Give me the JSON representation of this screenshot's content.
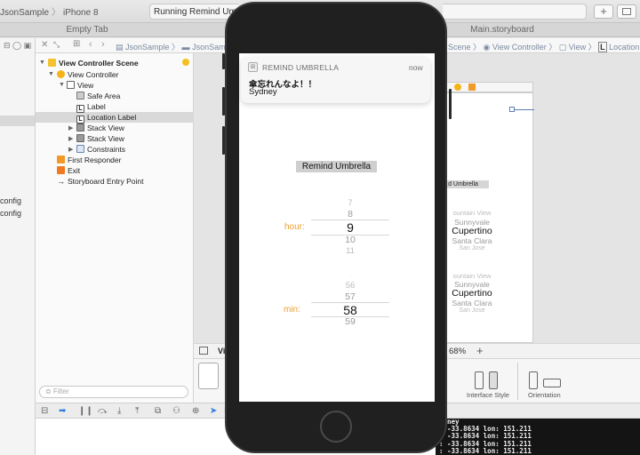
{
  "toolbar": {
    "scheme": "JsonSample",
    "device": "iPhone 8",
    "activity_status": "Running Remind Umbrella",
    "add_label": "+"
  },
  "tabs": {
    "left": "Empty Tab",
    "right": "Main.storyboard"
  },
  "navigator": {
    "config_items": [
      "config",
      "config"
    ]
  },
  "jumpbar": {
    "left": [
      "JsonSample",
      "JsonSample"
    ],
    "right": [
      "Scene",
      "View Controller",
      "View",
      "Location Label"
    ]
  },
  "outline": {
    "items": [
      {
        "label": "View Controller Scene",
        "icon": "scene-icon"
      },
      {
        "label": "View Controller",
        "icon": "view-controller-icon"
      },
      {
        "label": "View",
        "icon": "view-icon"
      },
      {
        "label": "Safe Area",
        "icon": "safe-area-icon"
      },
      {
        "label": "Label",
        "icon": "label-icon"
      },
      {
        "label": "Location Label",
        "icon": "label-icon"
      },
      {
        "label": "Stack View",
        "icon": "stack-view-icon"
      },
      {
        "label": "Stack View",
        "icon": "stack-view-icon"
      },
      {
        "label": "Constraints",
        "icon": "constraints-icon"
      },
      {
        "label": "First Responder",
        "icon": "first-responder-icon"
      },
      {
        "label": "Exit",
        "icon": "exit-icon"
      },
      {
        "label": "Storyboard Entry Point",
        "icon": "entry-arrow-icon"
      }
    ],
    "filter_placeholder": "Filter"
  },
  "canvas": {
    "button_label": "d Umbrella",
    "picker1": [
      "ountain View",
      "Sunnyvale",
      "Cupertino",
      "Santa Clara",
      "San Jose"
    ],
    "picker2": [
      "ountain View",
      "Sunnyvale",
      "Cupertino",
      "Santa Clara",
      "San Jose"
    ]
  },
  "bottombar": {
    "view_as_prefix": "Vi",
    "zoom": "68%",
    "zoom_plus": "+",
    "interface_style_label": "Interface Style",
    "orientation_label": "Orientation"
  },
  "console": {
    "lines": [
      "ydney",
      ": -33.8634 lon: 151.211",
      ": -33.8634 lon: 151.211",
      ": -33.8634 lon: 151.211",
      ": -33.8634 lon: 151.211"
    ]
  },
  "notification": {
    "app_name": "REMIND UMBRELLA",
    "time": "now",
    "title": "傘忘れんなよ！！",
    "body": "Sydney"
  },
  "app": {
    "remind_button": "Remind Umbrella",
    "hour_label": "hour:",
    "min_label": "min:",
    "hour_options": [
      "7",
      "8",
      "9",
      "10",
      "11"
    ],
    "hour_selected": "9",
    "min_options": [
      "56",
      "57",
      "58",
      "59"
    ],
    "min_selected": "58"
  },
  "colors": {
    "accent": "#f0a030",
    "xcode_blue": "#2f7de1"
  }
}
